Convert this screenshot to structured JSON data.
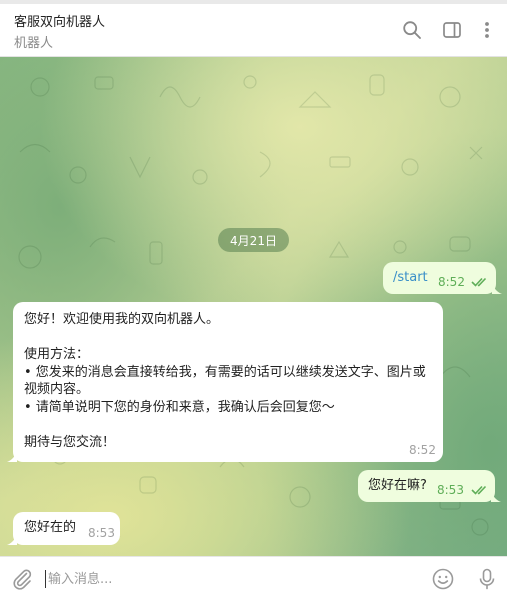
{
  "header": {
    "title": "客服双向机器人",
    "subtitle": "机器人",
    "icons": [
      "search-icon",
      "sidebar-toggle-icon",
      "more-vertical-icon"
    ]
  },
  "chat": {
    "date_label": "4月21日",
    "messages": [
      {
        "direction": "out",
        "text": "/start",
        "time": "8:52",
        "read": true
      },
      {
        "direction": "in",
        "text": "您好！欢迎使用我的双向机器人。\n\n使用方法：\n• 您发来的消息会直接转给我，有需要的话可以继续发送文字、图片或\n视频内容。\n• 请简单说明下您的身份和来意，我确认后会回复您～\n\n期待与您交流！",
        "time": "8:52"
      },
      {
        "direction": "out",
        "text": "您好在嘛?",
        "time": "8:53",
        "read": true
      },
      {
        "direction": "in",
        "text": "您好在的",
        "time": "8:53"
      }
    ]
  },
  "composer": {
    "placeholder": "输入消息...",
    "icons": [
      "paperclip-icon",
      "emoji-icon",
      "microphone-icon"
    ]
  },
  "colors": {
    "outgoing_bubble": "#effdde",
    "incoming_bubble": "#ffffff",
    "accent_green": "#5fae58",
    "link_blue": "#3a8fc8"
  }
}
